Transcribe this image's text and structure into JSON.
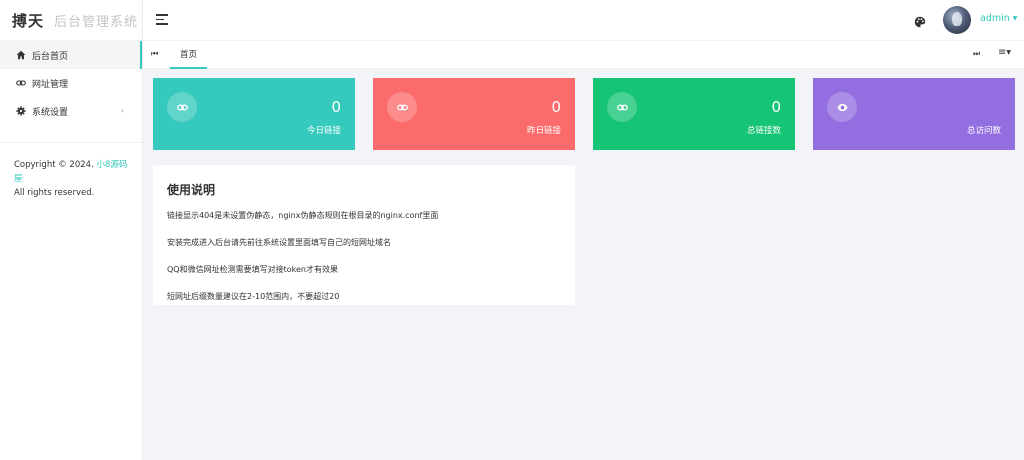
{
  "sidebar": {
    "brand_main": "搏天",
    "brand_sub": "后台管理系统",
    "items": [
      {
        "label": "后台首页",
        "icon": "home-icon"
      },
      {
        "label": "网址管理",
        "icon": "link-icon"
      },
      {
        "label": "系统设置",
        "icon": "gear-icon"
      }
    ],
    "copyright_prefix": "Copyright © 2024.",
    "copyright_link": "小8源码屋",
    "copyright_suffix": "All rights reserved."
  },
  "header": {
    "menu_icon": "hamburger-icon",
    "theme_icon": "palette-icon",
    "username": "admin"
  },
  "tabs": {
    "items": [
      {
        "label": "首页"
      }
    ]
  },
  "stats": [
    {
      "value": "0",
      "label": "今日链接",
      "icon": "link-icon",
      "color": "#36c9bd"
    },
    {
      "value": "0",
      "label": "昨日链接",
      "icon": "link-icon",
      "color": "#fb6b6b"
    },
    {
      "value": "0",
      "label": "总链接数",
      "icon": "link-icon",
      "color": "#16c475"
    },
    {
      "value": "",
      "label": "总访问数",
      "icon": "eye-icon",
      "color": "#936ee0"
    }
  ],
  "instructions": {
    "title": "使用说明",
    "lines": [
      "链接显示404是未设置伪静态，nginx伪静态规则在根目录的nginx.conf里面",
      "安装完成进入后台请先前往系统设置里面填写自己的短网址域名",
      "QQ和微信网址检测需要填写对接token才有效果",
      "短网址后缀数量建议在2-10范围内，不要超过20"
    ]
  }
}
